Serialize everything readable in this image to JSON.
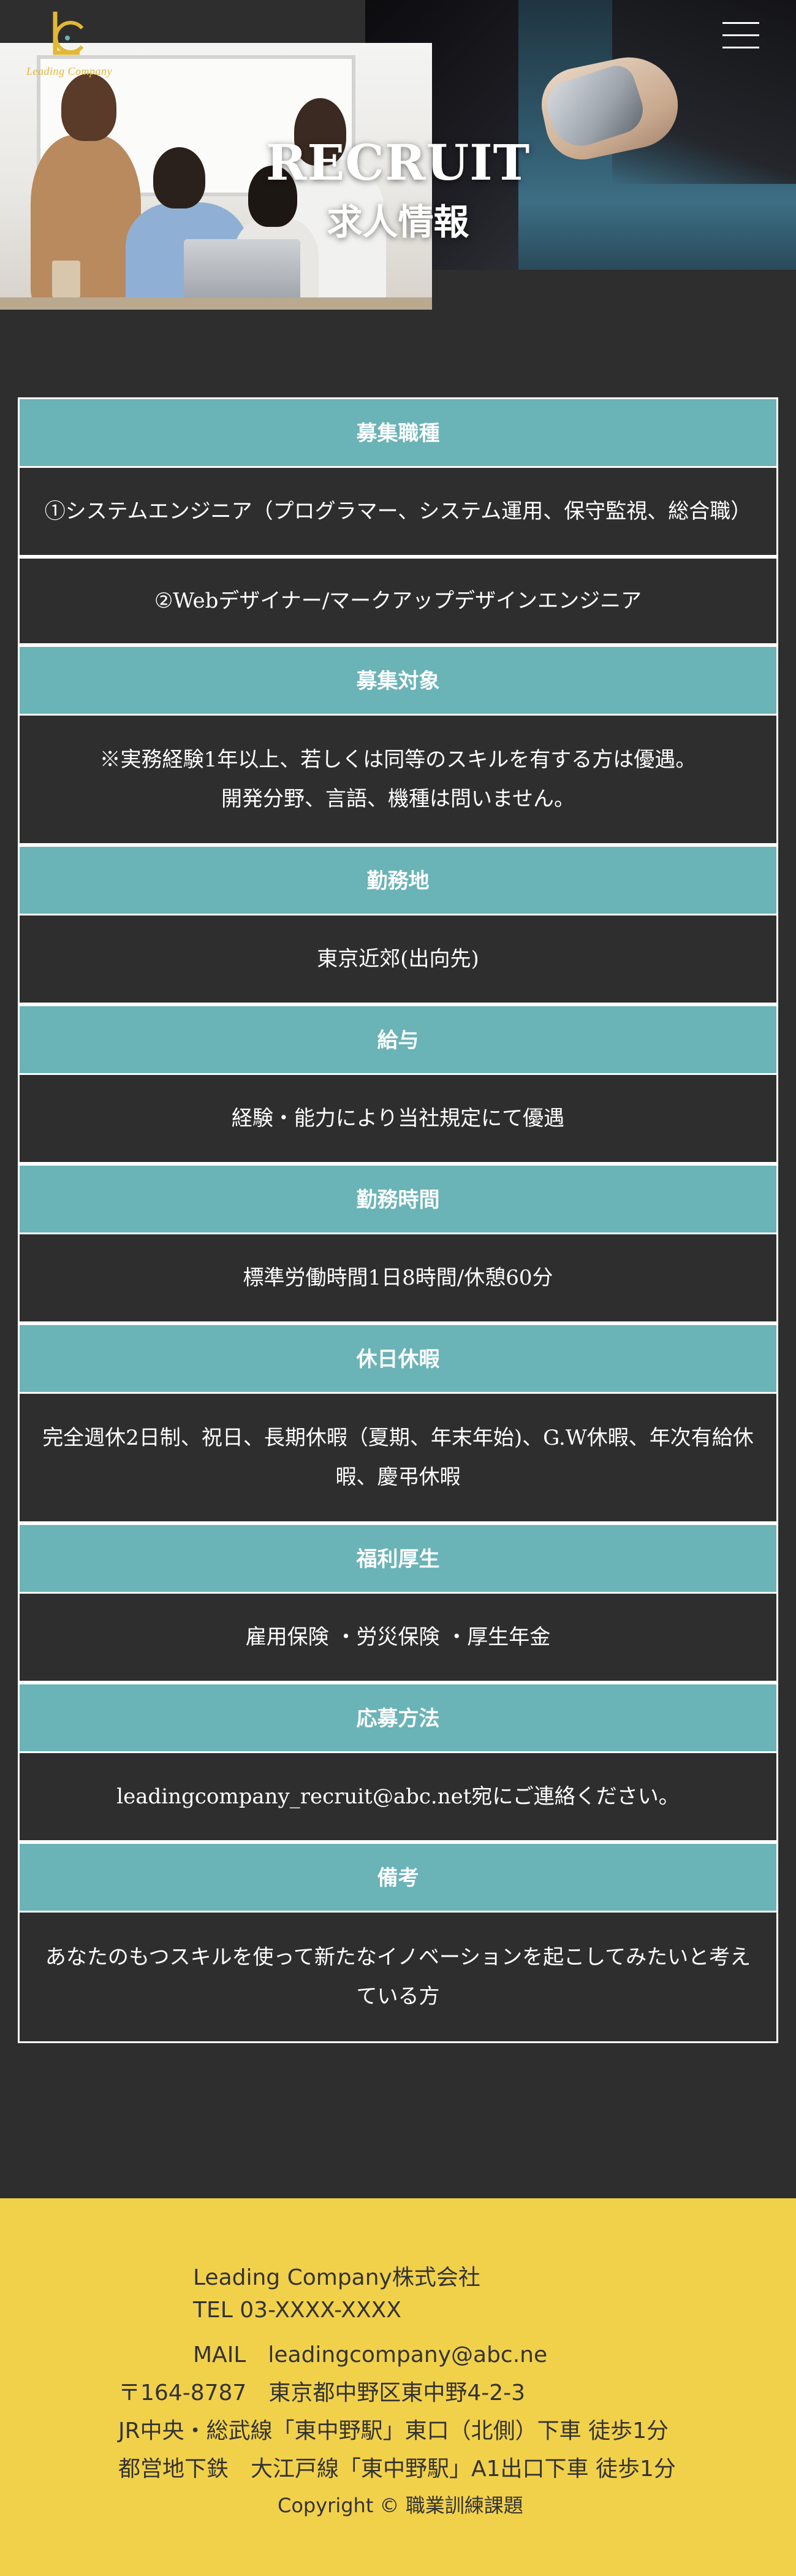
{
  "brand": {
    "logo_text": "Leading Company",
    "accent_color": "#e2b834"
  },
  "header": {
    "menu_icon": "hamburger-menu-icon"
  },
  "hero": {
    "title": "RECRUIT",
    "subtitle": "求人情報"
  },
  "recruit": {
    "rows": [
      {
        "label": "募集職種",
        "lines": [
          "①システムエンジニア（プログラマー、システム運用、保守監視、総合職）"
        ]
      },
      {
        "label": "",
        "lines": [
          "②Webデザイナー/マークアップデザインエンジニア"
        ]
      },
      {
        "label": "募集対象",
        "lines": [
          "※実務経験1年以上、若しくは同等のスキルを有する方は優遇。",
          "開発分野、言語、機種は問いません。"
        ]
      },
      {
        "label": "勤務地",
        "lines": [
          "東京近郊(出向先)"
        ]
      },
      {
        "label": "給与",
        "lines": [
          "経験・能力により当社規定にて優遇"
        ]
      },
      {
        "label": "勤務時間",
        "lines": [
          "標準労働時間1日8時間/休憩60分"
        ]
      },
      {
        "label": "休日休暇",
        "lines": [
          "完全週休2日制、祝日、長期休暇（夏期、年末年始)、G.W休暇、年次有給休",
          "暇、慶弔休暇"
        ]
      },
      {
        "label": "福利厚生",
        "lines": [
          "雇用保険 ・労災保険 ・厚生年金"
        ]
      },
      {
        "label": "応募方法",
        "lines": [
          "leadingcompany_recruit@abc.net宛にご連絡ください。"
        ]
      },
      {
        "label": "備考",
        "lines": [
          "あなたのもつスキルを使って新たなイノベーションを起こしてみたいと考え",
          "ている方"
        ]
      }
    ],
    "header_color": "#6ab3b7"
  },
  "footer": {
    "company": "Leading Company株式会社",
    "tel": "TEL 03-XXXX-XXXX",
    "mail": "MAIL　leadingcompany@abc.ne",
    "address": "〒164-8787　東京都中野区東中野4-2-3",
    "access1": "JR中央・総武線「東中野駅」東口（北側）下車 徒歩1分",
    "access2": "都営地下鉄　大江戸線「東中野駅」A1出口下車 徒歩1分",
    "copyright": "Copyright © 職業訓練課題",
    "background_color": "#f2d14a"
  }
}
